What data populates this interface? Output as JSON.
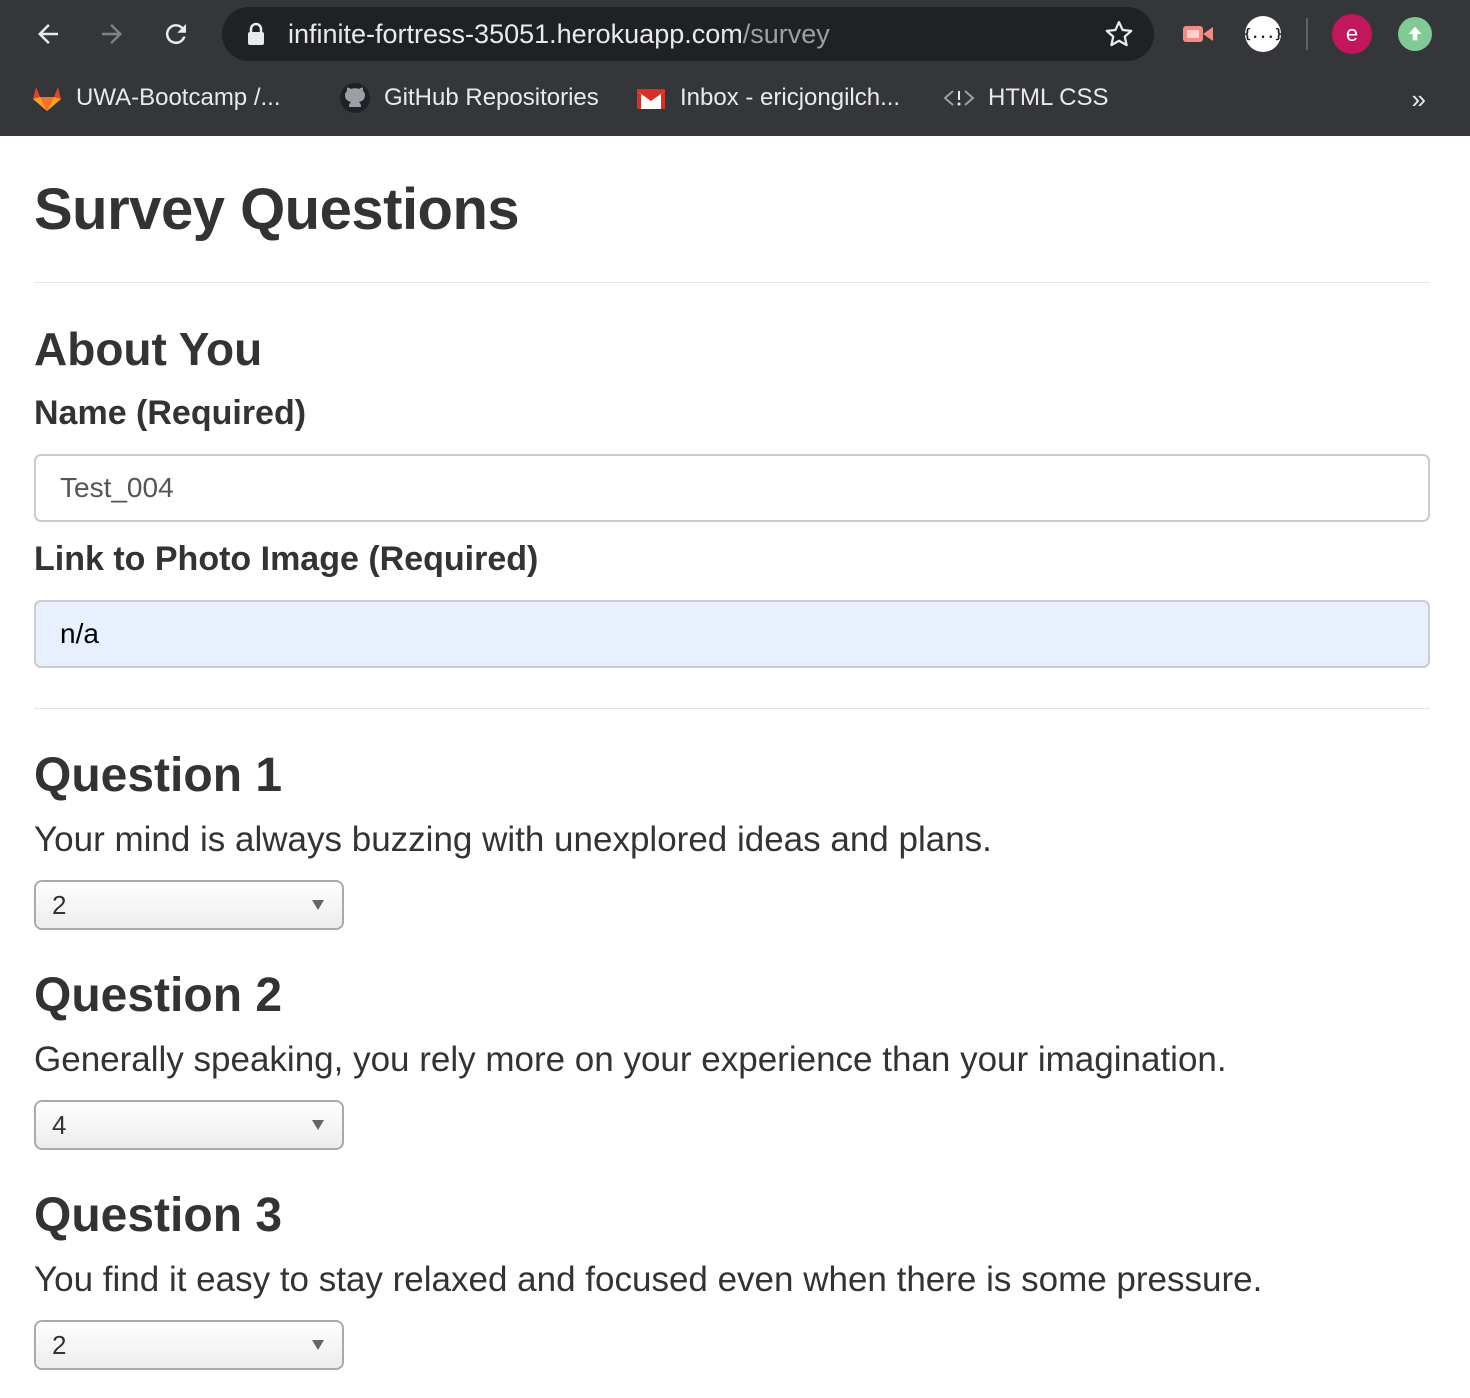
{
  "browser": {
    "url_host": "infinite-fortress-35051.herokuapp.com",
    "url_path": "/survey",
    "avatar_letter": "e",
    "bookmarks": [
      {
        "label": "UWA-Bootcamp /...",
        "icon": "gitlab-icon"
      },
      {
        "label": "GitHub Repositories",
        "icon": "github-icon"
      },
      {
        "label": "Inbox - ericjongilch...",
        "icon": "gmail-icon"
      },
      {
        "label": "HTML CSS",
        "icon": "code-icon"
      }
    ],
    "more_label": "»"
  },
  "page": {
    "title": "Survey Questions",
    "about": {
      "heading": "About You",
      "name_label": "Name (Required)",
      "name_value": "Test_004",
      "photo_label": "Link to Photo Image (Required)",
      "photo_value": "n/a"
    },
    "questions": [
      {
        "heading": "Question 1",
        "text": "Your mind is always buzzing with unexplored ideas and plans.",
        "selected": "2"
      },
      {
        "heading": "Question 2",
        "text": "Generally speaking, you rely more on your experience than your imagination.",
        "selected": "4"
      },
      {
        "heading": "Question 3",
        "text": "You find it easy to stay relaxed and focused even when there is some pressure.",
        "selected": "2"
      }
    ]
  }
}
